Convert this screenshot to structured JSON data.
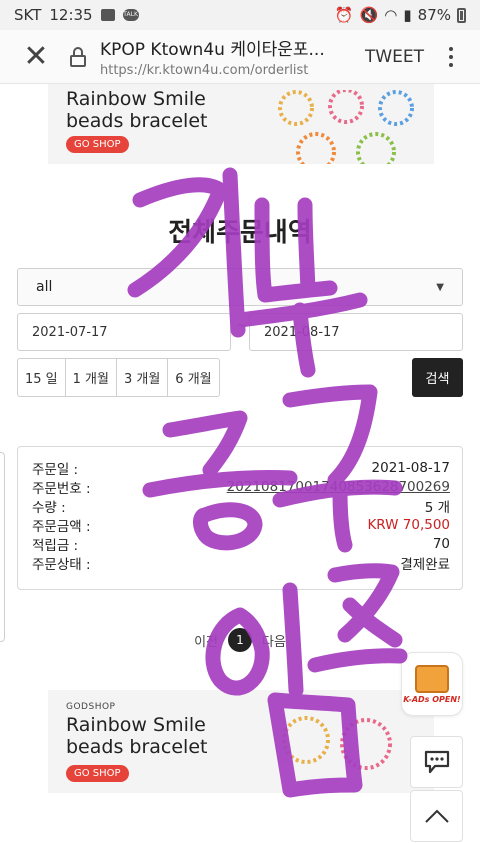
{
  "status_bar": {
    "carrier": "SKT",
    "time": "12:35",
    "battery": "87%"
  },
  "browser": {
    "tab_title": "KPOP Ktown4u 케이타운포...",
    "url": "https://kr.ktown4u.com/orderlist",
    "tweet_label": "TWEET"
  },
  "banner_top": {
    "line1": "Rainbow Smile",
    "line2": "beads bracelet",
    "cta": "GO SHOP"
  },
  "banner_bottom": {
    "brand": "GODSHOP",
    "line1": "Rainbow Smile",
    "line2": "beads bracelet",
    "cta": "GO SHOP"
  },
  "page": {
    "title": "전체주문내역"
  },
  "filters": {
    "status_select": "all",
    "date_from": "2021-07-17",
    "date_separator": "~",
    "date_to": "2021-08-17",
    "periods": [
      "15 일",
      "1 개월",
      "3 개월",
      "6 개월"
    ],
    "search_label": "검색"
  },
  "order": {
    "rows": [
      {
        "label": "주문일 :",
        "value": "2021-08-17"
      },
      {
        "label": "주문번호 :",
        "value": "20210817001740853628700269"
      },
      {
        "label": "수량 :",
        "value": "5 개"
      },
      {
        "label": "주문금액 :",
        "value": "KRW 70,500"
      },
      {
        "label": "적립금 :",
        "value": "70"
      },
      {
        "label": "주문상태 :",
        "value": "결제완료"
      }
    ]
  },
  "pagination": {
    "prev": "이전",
    "current": "1",
    "next": "다음"
  },
  "floating": {
    "ad_text": "K-ADs OPEN!"
  },
  "colors": {
    "accent_red": "#e6443a",
    "price_red": "#c92222",
    "overlay_purple": "#a53ec0"
  },
  "overlay_handwriting": "기부 공구 이즘"
}
